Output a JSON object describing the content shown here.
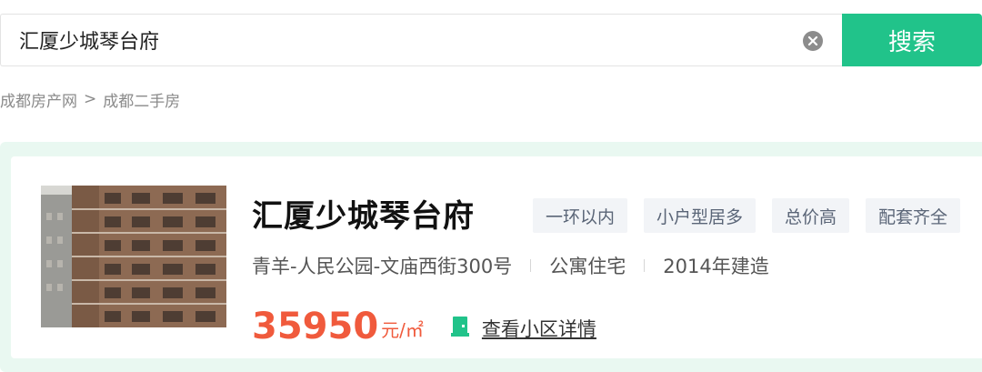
{
  "search": {
    "value": "汇厦少城琴台府",
    "button_label": "搜索"
  },
  "breadcrumb": {
    "items": [
      "成都房产网",
      "成都二手房"
    ],
    "separator": ">"
  },
  "listing": {
    "title": "汇厦少城琴台府",
    "tags": [
      "一环以内",
      "小户型居多",
      "总价高",
      "配套齐全"
    ],
    "address": "青羊-人民公园-文庙西街300号",
    "property_type": "公寓住宅",
    "build_year": "2014年建造",
    "price": "35950",
    "price_unit": "元/㎡",
    "detail_link": "查看小区详情",
    "detail_icon": "door-icon",
    "image": "building-photo"
  },
  "colors": {
    "accent": "#21c38a",
    "price": "#f05a3c",
    "card_bg": "#e9f8f1",
    "tag_bg": "#f2f4f7"
  }
}
